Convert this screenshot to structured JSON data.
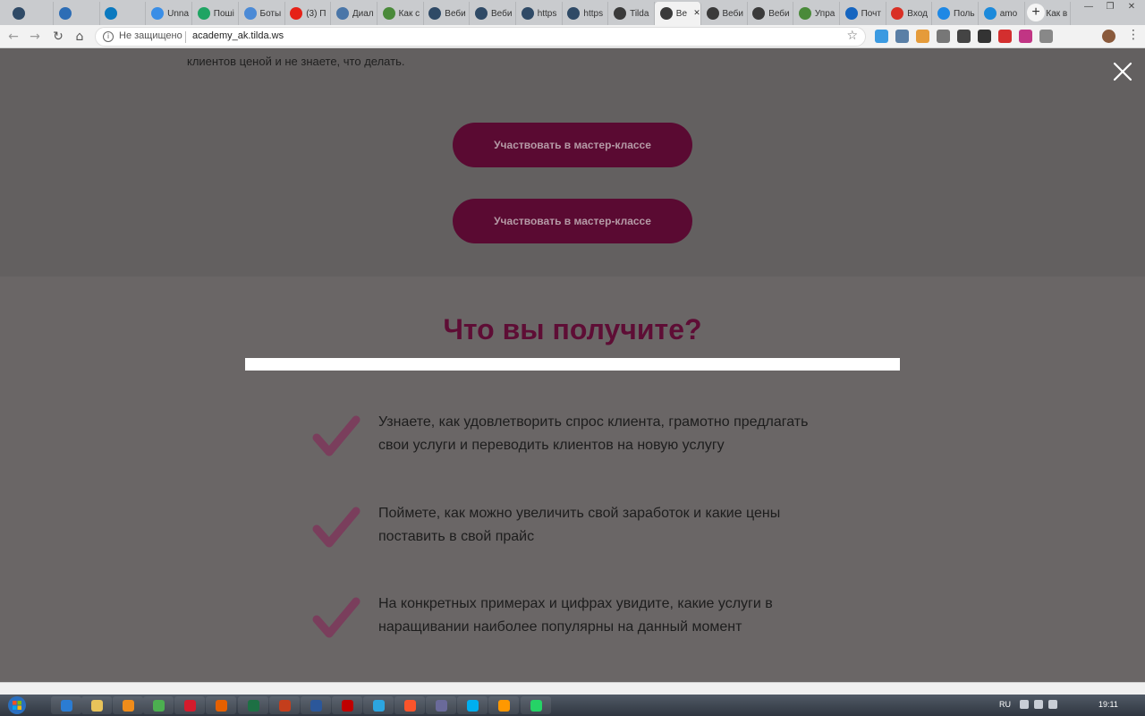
{
  "browser": {
    "tabs": [
      {
        "title": "",
        "icon": "gc-icon",
        "color": "#2f4a66",
        "active": false
      },
      {
        "title": "",
        "icon": "shield-icon",
        "color": "#2d6db5",
        "active": false
      },
      {
        "title": "",
        "icon": "trello-icon",
        "color": "#0a79bf",
        "active": false
      },
      {
        "title": "Unna",
        "icon": "window-icon",
        "color": "#3a8ee6",
        "active": false
      },
      {
        "title": "Поші",
        "icon": "drive-icon",
        "color": "#1fa463",
        "active": false
      },
      {
        "title": "Боты",
        "icon": "globe-icon",
        "color": "#4b8ad6",
        "active": false
      },
      {
        "title": "(3) П",
        "icon": "youtube-icon",
        "color": "#e62117",
        "active": false
      },
      {
        "title": "Диал",
        "icon": "chat-icon",
        "color": "#4a76a8",
        "active": false
      },
      {
        "title": "Как с",
        "icon": "leaf-icon",
        "color": "#4a8a3a",
        "active": false
      },
      {
        "title": "Веби",
        "icon": "gc-icon",
        "color": "#2f4a66",
        "active": false
      },
      {
        "title": "Веби",
        "icon": "gc-icon",
        "color": "#2f4a66",
        "active": false
      },
      {
        "title": "https",
        "icon": "gc-icon",
        "color": "#2f4a66",
        "active": false
      },
      {
        "title": "https",
        "icon": "gc-icon",
        "color": "#2f4a66",
        "active": false
      },
      {
        "title": "Tilda",
        "icon": "tilda-icon",
        "color": "#3a3a3a",
        "active": false
      },
      {
        "title": "Ве",
        "icon": "tilda-icon",
        "color": "#3a3a3a",
        "active": true
      },
      {
        "title": "Веби",
        "icon": "tilda-icon",
        "color": "#3a3a3a",
        "active": false
      },
      {
        "title": "Веби",
        "icon": "tilda-icon",
        "color": "#3a3a3a",
        "active": false
      },
      {
        "title": "Упра",
        "icon": "leaf-icon",
        "color": "#4a8a3a",
        "active": false
      },
      {
        "title": "Почт",
        "icon": "at-icon",
        "color": "#1565c0",
        "active": false
      },
      {
        "title": "Вход",
        "icon": "gmail-icon",
        "color": "#d93025",
        "active": false
      },
      {
        "title": "Поль",
        "icon": "puzzle-icon",
        "color": "#1e88e5",
        "active": false
      },
      {
        "title": "amo",
        "icon": "amo-icon",
        "color": "#1c8adb",
        "active": false
      },
      {
        "title": "Как в",
        "icon": "gc-icon",
        "color": "#2f4a66",
        "active": false
      }
    ],
    "tab_close_glyph": "✕",
    "new_tab_glyph": "+",
    "window_controls": [
      "—",
      "❐",
      "✕"
    ],
    "security_text": "Не защищено",
    "url": "academy_ak.tilda.ws",
    "extension_colors": [
      "#3b9ae1",
      "#5a7fa6",
      "#e59b3a",
      "#777777",
      "#444444",
      "#333333",
      "#d32f2f",
      "#c13584",
      "#888888"
    ]
  },
  "page": {
    "intro_text": "клиентов ценой и не знаете, что делать.",
    "cta_buttons": [
      {
        "label": "Участвовать в мастер-классе"
      },
      {
        "label": "Участвовать в мастер-классе"
      }
    ],
    "heading": "Что вы получите?",
    "accent_color": "#5e0d35",
    "check_color": "#7a3e5c",
    "benefits": [
      {
        "line1": "Узнаете, как удовлетворить спрос клиента, грамотно предлагать",
        "line2": "свои услуги и переводить клиентов на новую услугу"
      },
      {
        "line1": "Поймете, как можно увеличить свой заработок и какие цены",
        "line2": "поставить в свой прайс"
      },
      {
        "line1": "На конкретных примерах и цифрах увидите, какие услуги в",
        "line2": "наращивании наиболее популярны на данный момент"
      }
    ]
  },
  "taskbar": {
    "apps": [
      {
        "name": "ie-icon",
        "color": "#2b7cd3"
      },
      {
        "name": "explorer-icon",
        "color": "#e8c35a"
      },
      {
        "name": "media-player-icon",
        "color": "#f08c1a"
      },
      {
        "name": "chrome-icon",
        "color": "#4caf50"
      },
      {
        "name": "opera-icon",
        "color": "#d41b2c"
      },
      {
        "name": "firefox-icon",
        "color": "#e66000"
      },
      {
        "name": "excel-icon",
        "color": "#1d7044"
      },
      {
        "name": "powerpoint-icon",
        "color": "#c43e1c"
      },
      {
        "name": "word-icon",
        "color": "#2b579a"
      },
      {
        "name": "filezilla-icon",
        "color": "#bf0000"
      },
      {
        "name": "telegram-icon",
        "color": "#2ca5e0"
      },
      {
        "name": "brave-icon",
        "color": "#fb542b"
      },
      {
        "name": "keepass-icon",
        "color": "#6a6a9a"
      },
      {
        "name": "skype-icon",
        "color": "#00aff0"
      },
      {
        "name": "sublime-icon",
        "color": "#ff9800"
      },
      {
        "name": "whatsapp-icon",
        "color": "#25d366"
      }
    ],
    "language": "RU",
    "clock": "19:11"
  }
}
